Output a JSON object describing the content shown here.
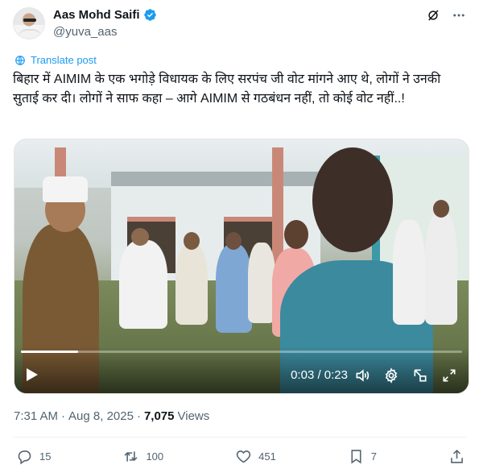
{
  "author": {
    "display_name": "Aas Mohd Saifi",
    "handle": "@yuva_aas",
    "verified": true
  },
  "header_icons": [
    "grok-icon",
    "more-icon"
  ],
  "translate_label": "Translate post",
  "tweet_text": "बिहार में AIMIM के एक भगोड़े विधायक के लिए सरपंच जी वोट मांगने आए थे, लोगों ने उनकी सुताई कर दी। लोगों ने साफ कहा – आगे AIMIM से गठबंधन नहीं, तो कोई वोट नहीं..!",
  "video": {
    "time_display": "0:03 / 0:23",
    "progress": 0.13
  },
  "meta": {
    "time": "7:31 AM",
    "separator": "·",
    "date": "Aug 8, 2025",
    "views_count": "7,075",
    "views_label": "Views"
  },
  "actions": {
    "replies": "15",
    "reposts": "100",
    "likes": "451",
    "bookmarks": "7"
  },
  "colors": {
    "accent": "#1d9bf0",
    "text": "#0f1419",
    "secondary": "#536471"
  }
}
